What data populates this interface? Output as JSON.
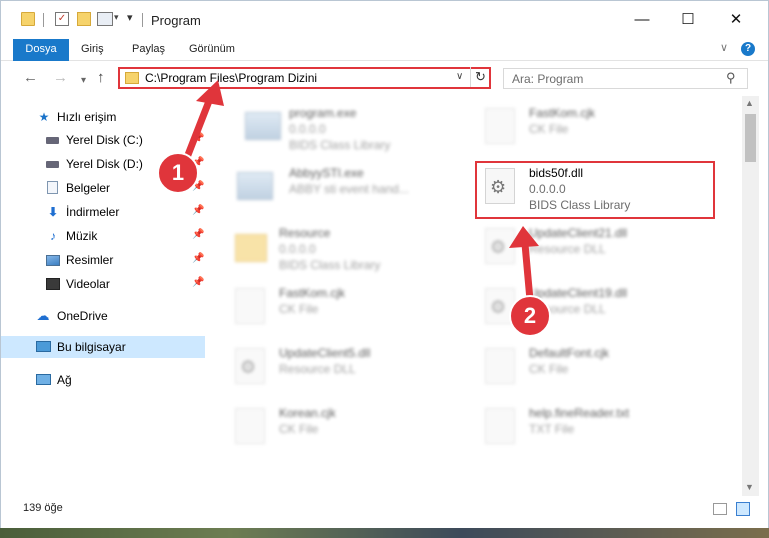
{
  "window": {
    "title": "Program"
  },
  "ribbon": {
    "tabs": [
      "Dosya",
      "Giriş",
      "Paylaş",
      "Görünüm"
    ],
    "help": "?"
  },
  "nav": {
    "address": "C:\\Program Files\\Program Dizini",
    "search_placeholder": "Ara: Program"
  },
  "sidebar": {
    "items": [
      {
        "label": "Hızlı erişim"
      },
      {
        "label": "Yerel Disk (C:)"
      },
      {
        "label": "Yerel Disk (D:)"
      },
      {
        "label": "Belgeler"
      },
      {
        "label": "İndirmeler"
      },
      {
        "label": "Müzik"
      },
      {
        "label": "Resimler"
      },
      {
        "label": "Videolar"
      },
      {
        "label": "OneDrive"
      },
      {
        "label": "Bu bilgisayar",
        "selected": true
      },
      {
        "label": "Ağ"
      }
    ]
  },
  "files": [
    {
      "name": "program.exe",
      "line2": "0.0.0.0",
      "line3": "BIDS Class Library",
      "icon": "app",
      "blurred": true
    },
    {
      "name": "FastKom.cjk",
      "line2": "CK File",
      "line3": "",
      "icon": "doc",
      "blurred": true
    },
    {
      "name": "AbbyySTI.exe",
      "line2": "ABBY sti event hand...",
      "line3": "",
      "icon": "app",
      "blurred": true
    },
    {
      "name": "bids50f.dll",
      "line2": "0.0.0.0",
      "line3": "BIDS Class Library",
      "icon": "gear",
      "blurred": false
    },
    {
      "name": "Resource",
      "line2": "0.0.0.0",
      "line3": "BIDS Class Library",
      "icon": "folder",
      "blurred": true
    },
    {
      "name": "UpdateClient21.dll",
      "line2": "Resource DLL",
      "line3": "",
      "icon": "gear",
      "blurred": true
    },
    {
      "name": "FastKom.cjk",
      "line2": "CK File",
      "line3": "",
      "icon": "doc",
      "blurred": true
    },
    {
      "name": "UpdateClient19.dll",
      "line2": "Resource DLL",
      "line3": "",
      "icon": "gear",
      "blurred": true
    },
    {
      "name": "UpdateClient5.dll",
      "line2": "Resource DLL",
      "line3": "",
      "icon": "gear",
      "blurred": true
    },
    {
      "name": "DefaultFont.cjk",
      "line2": "CK File",
      "line3": "",
      "icon": "doc",
      "blurred": true
    },
    {
      "name": "Korean.cjk",
      "line2": "CK File",
      "line3": "",
      "icon": "doc",
      "blurred": true
    },
    {
      "name": "help.fineReader.txt",
      "line2": "TXT File",
      "line3": "",
      "icon": "doc",
      "blurred": true
    }
  ],
  "status": {
    "count": "139 öğe"
  },
  "annotations": {
    "badge1": "1",
    "badge2": "2",
    "color": "#e0353b"
  }
}
